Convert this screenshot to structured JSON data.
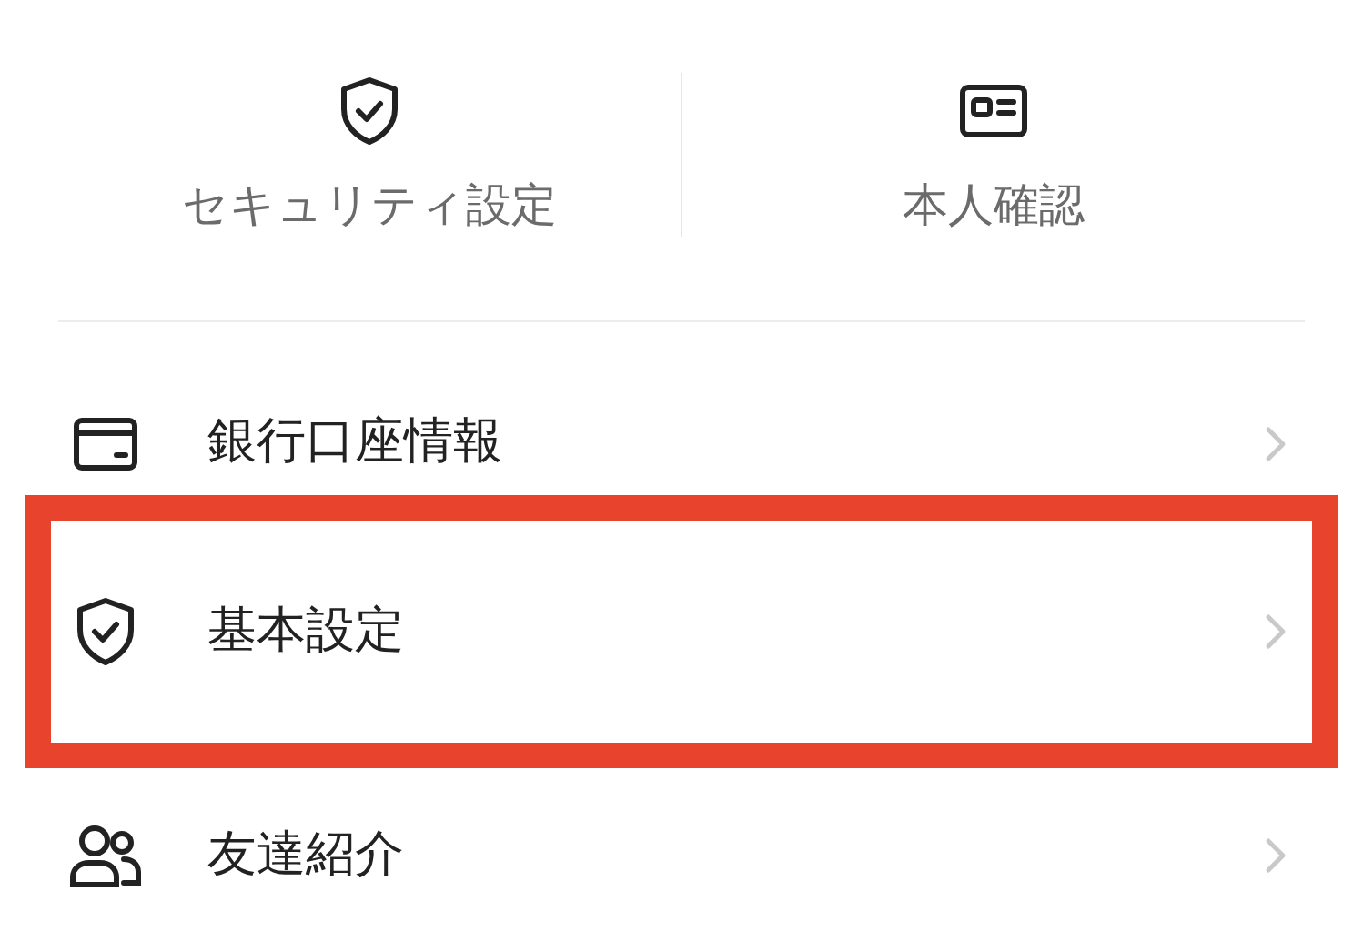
{
  "shortcuts": [
    {
      "kind": "shield",
      "label": "セキュリティ設定"
    },
    {
      "kind": "id-card",
      "label": "本人確認"
    }
  ],
  "menu": [
    {
      "kind": "card",
      "label": "銀行口座情報",
      "highlighted": false
    },
    {
      "kind": "shield",
      "label": "基本設定",
      "highlighted": true
    },
    {
      "kind": "people",
      "label": "友達紹介",
      "highlighted": false
    }
  ]
}
